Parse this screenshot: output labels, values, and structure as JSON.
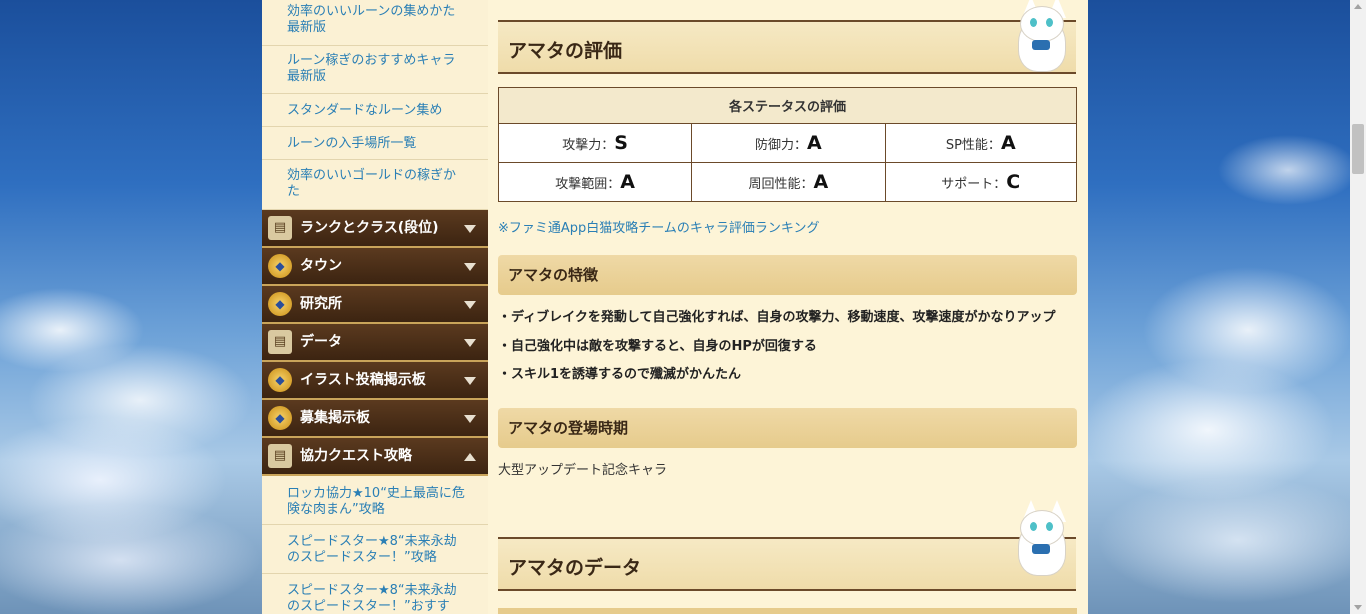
{
  "sidebar": {
    "top_links": [
      "効率のいいルーンの集めかた最新版",
      "ルーン稼ぎのおすすめキャラ最新版",
      "スタンダードなルーン集め",
      "ルーンの入手場所一覧",
      "効率のいいゴールドの稼ぎかた"
    ],
    "categories": [
      {
        "label": "ランクとクラス(段位)",
        "icon": "book-icon"
      },
      {
        "label": "タウン",
        "icon": "shield-icon"
      },
      {
        "label": "研究所",
        "icon": "shield-icon"
      },
      {
        "label": "データ",
        "icon": "book-icon"
      },
      {
        "label": "イラスト投稿掲示板",
        "icon": "shield-icon"
      },
      {
        "label": "募集掲示板",
        "icon": "shield-icon"
      },
      {
        "label": "協力クエスト攻略",
        "icon": "book-icon"
      }
    ],
    "bottom_links": [
      "ロッカ協力★10“史上最高に危険な肉まん”攻略",
      "スピードスター★8“未来永劫のスピードスター！”攻略",
      "スピードスター★8“未来永劫のスピードスター！”おすす"
    ]
  },
  "main": {
    "eval_title": "アマタの評価",
    "table": {
      "header": "各ステータスの評価",
      "rows": [
        [
          {
            "label": "攻撃力：",
            "grade": "S"
          },
          {
            "label": "防御力：",
            "grade": "A"
          },
          {
            "label": "SP性能：",
            "grade": "A"
          }
        ],
        [
          {
            "label": "攻撃範囲：",
            "grade": "A"
          },
          {
            "label": "周回性能：",
            "grade": "A"
          },
          {
            "label": "サポート：",
            "grade": "C"
          }
        ]
      ]
    },
    "ranking_link": "※ファミ通App白猫攻略チームのキャラ評価ランキング",
    "features_title": "アマタの特徴",
    "features": [
      "・ディブレイクを発動して自己強化すれば、自身の攻撃力、移動速度、攻撃速度がかなりアップ",
      "・自己強化中は敵を攻撃すると、自身のHPが回復する",
      "・スキル1を誘導するので殲滅がかんたん"
    ],
    "release_title": "アマタの登場時期",
    "release_text": "大型アップデート記念キャラ",
    "data_title": "アマタのデータ"
  },
  "colors": {
    "link": "#2a7fb5",
    "sidebar_bg": "#fbf1d4",
    "category_bg": "#4a2e16"
  }
}
